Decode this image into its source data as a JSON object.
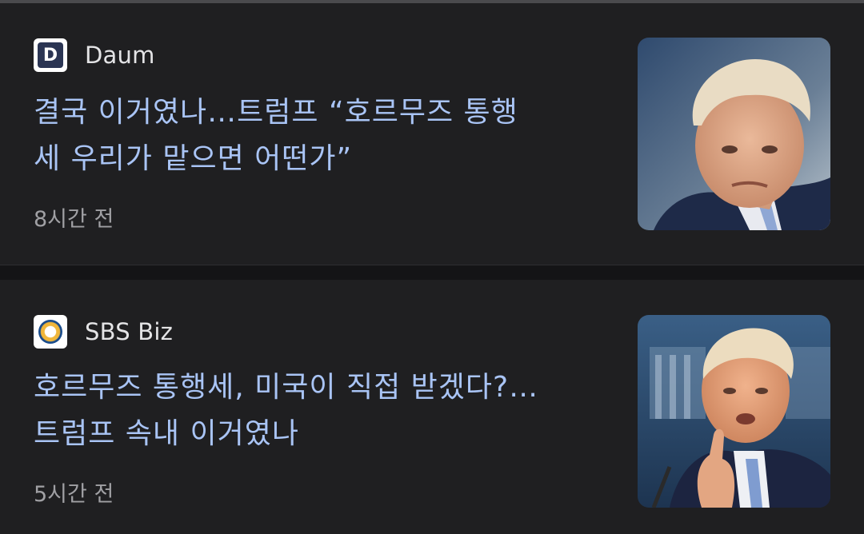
{
  "articles": [
    {
      "source": "Daum",
      "source_icon": "daum-logo-icon",
      "headline_line1": "결국 이거였나…트럼프 “호르무즈 통행",
      "headline_line2": "세 우리가 맡으면 어떤가”",
      "time": "8시간 전",
      "thumbnail": "portrait-photo"
    },
    {
      "source": "SBS Biz",
      "source_icon": "sbs-biz-logo-icon",
      "headline_line1": "호르무즈 통행세, 미국이 직접 받겠다?…",
      "headline_line2": "트럼프 속내 이거였나",
      "time": "5시간 전",
      "thumbnail": "portrait-photo"
    }
  ],
  "colors": {
    "background": "#1f1f21",
    "headline": "#a9c4f5",
    "source_text": "#e4e4e6",
    "time_text": "#a0a0a4"
  }
}
